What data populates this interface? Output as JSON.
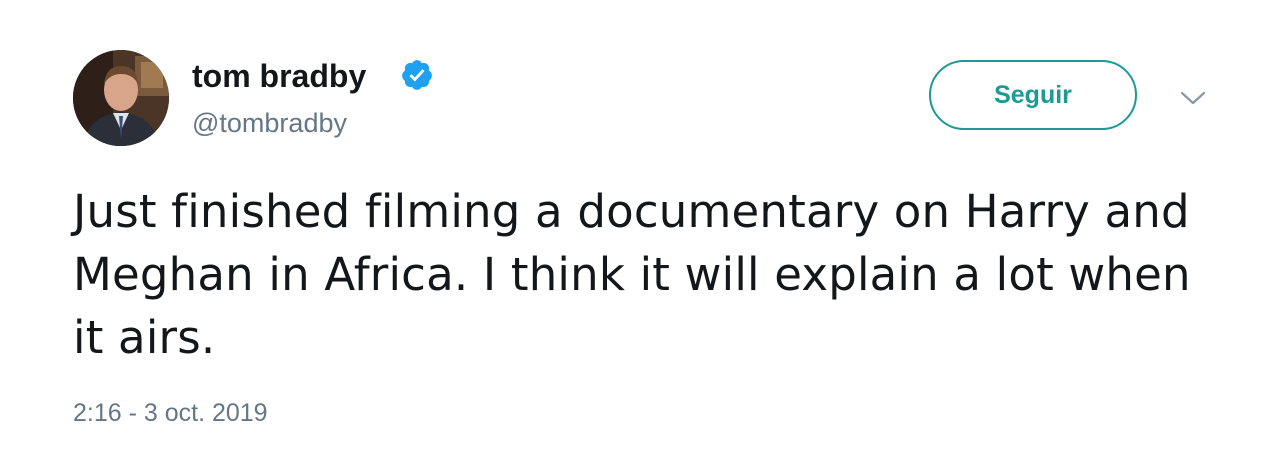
{
  "tweet": {
    "author": {
      "name": "tom bradby",
      "handle": "@tombradby",
      "verified": true,
      "avatar_icon": "user-avatar-photo"
    },
    "follow_label": "Seguir",
    "more_icon": "chevron-down-icon",
    "text": "Just finished filming a documentary on Harry and Meghan in Africa. I think it will explain a lot when it airs.",
    "timestamp": "2:16 - 3 oct. 2019"
  },
  "colors": {
    "accent": "#1c9a94",
    "verified": "#1da1f2",
    "text": "#14171a",
    "secondary": "#657786"
  }
}
